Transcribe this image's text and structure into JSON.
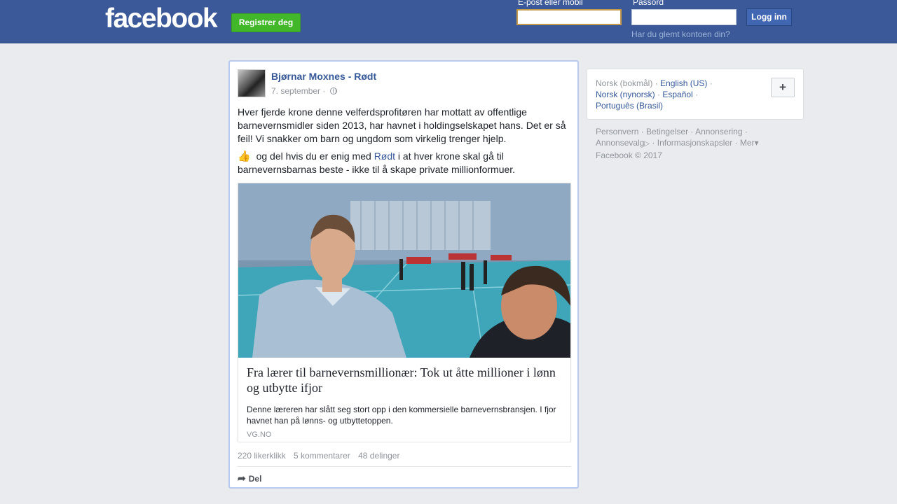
{
  "header": {
    "logo": "facebook",
    "register_label": "Registrer deg",
    "email_label": "E-post eller mobil",
    "password_label": "Passord",
    "login_label": "Logg inn",
    "forgot_label": "Har du glemt kontoen din?"
  },
  "post": {
    "author": "Bjørnar Moxnes - Rødt",
    "date": "7. september",
    "separator": "·",
    "paragraph1": "Hver fjerde krone denne velferdsprofitøren har mottatt av offentlige barnevernsmidler siden 2013, har havnet i holdingselskapet hans. Det er så feil! Vi snakker om barn og ungdom som virkelig trenger hjelp.",
    "thumb_glyph": "👍",
    "paragraph2_pre": "og del hvis du er enig med",
    "paragraph2_mention": "Rødt",
    "paragraph2_post": "i at hver krone skal gå til barnevernsbarnas beste - ikke til å skape private millionformuer.",
    "link": {
      "title": "Fra lærer til barnevernsmillionær: Tok ut åtte millioner i lønn og utbytte ifjor",
      "description": "Denne læreren har slått seg stort opp i den kommersielle barnevernsbransjen. I fjor havnet han på lønns- og utbyttetoppen.",
      "source": "VG.NO"
    },
    "stats": {
      "likes": "220 likerklikk",
      "comments": "5 kommentarer",
      "shares": "48 delinger"
    },
    "share_label": "Del"
  },
  "languages": {
    "current": "Norsk (bokmål)",
    "items": [
      "English (US)",
      "Norsk (nynorsk)",
      "Español",
      "Português (Brasil)"
    ],
    "add_label": "+"
  },
  "footer": {
    "links": [
      "Personvern",
      "Betingelser",
      "Annonsering",
      "Annonsevalg",
      "Informasjonskapsler",
      "Mer"
    ],
    "copyright": "Facebook © 2017"
  },
  "colors": {
    "brand": "#3b5998",
    "register": "#42b72a",
    "link": "#365899"
  }
}
